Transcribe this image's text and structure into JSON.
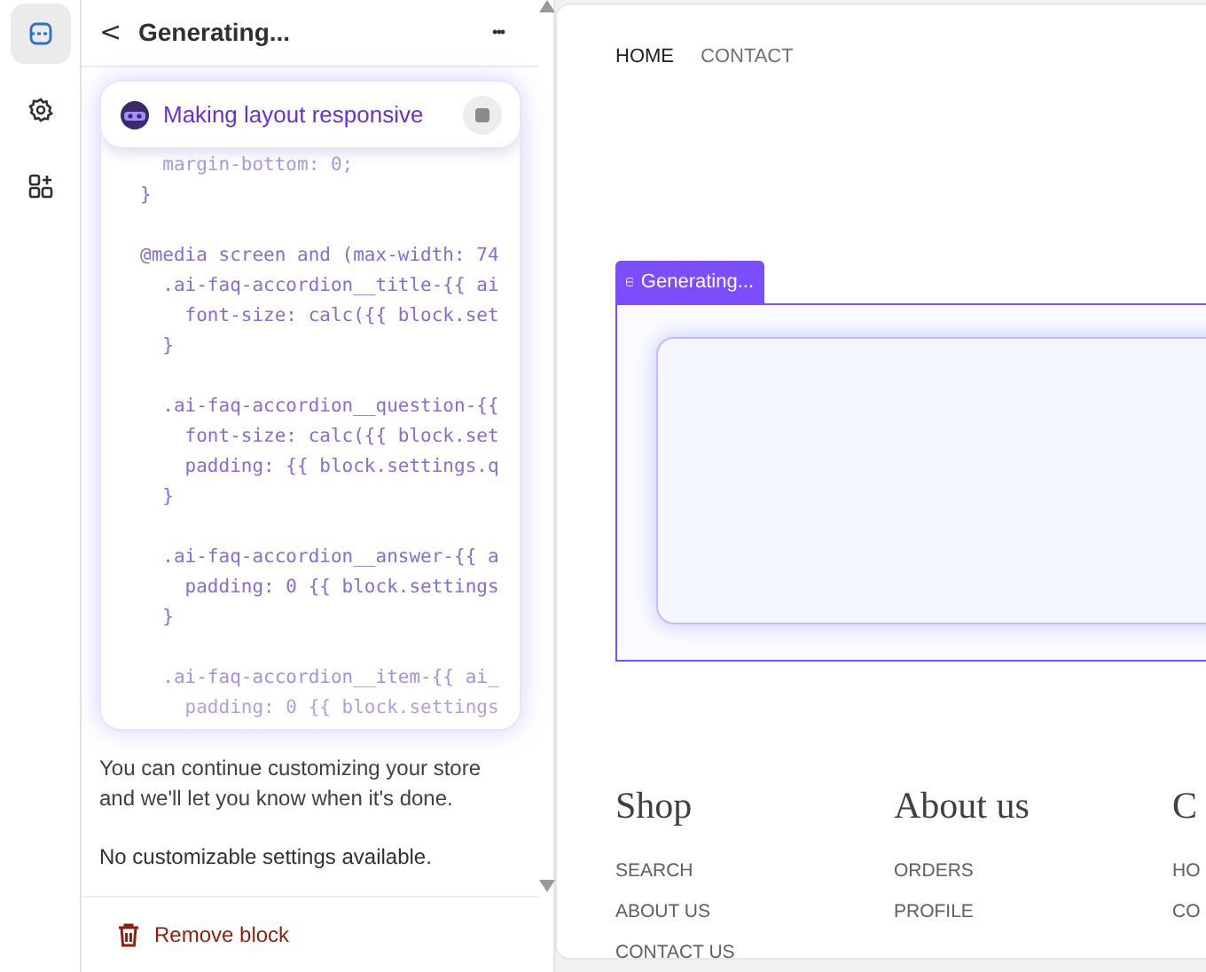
{
  "rail": [
    {
      "selected": true
    },
    {
      "selected": false
    },
    {
      "selected": false
    }
  ],
  "header": {
    "back": "<",
    "title": "Generating...",
    "more": "•••"
  },
  "status": {
    "text": "Making layout responsive"
  },
  "code_groups": [
    [
      "  margin-bottom: 0;",
      "}"
    ],
    [
      "@media screen and (max-width: 74",
      "  .ai-faq-accordion__title-{{ ai",
      "    font-size: calc({{ block.set",
      "  }"
    ],
    [
      "  .ai-faq-accordion__question-{{",
      "    font-size: calc({{ block.set",
      "    padding: {{ block.settings.q",
      "  }"
    ],
    [
      "  .ai-faq-accordion__answer-{{ a",
      "    padding: 0 {{ block.settings",
      "  }"
    ],
    [
      "  .ai-faq-accordion__item-{{ ai_",
      "    padding: 0 {{ block.settings"
    ]
  ],
  "info": "You can continue customizing your store and we'll let you know when it's done.",
  "no_settings": "No customizable settings available.",
  "remove_button": "Remove block",
  "preview": {
    "nav": [
      {
        "label": "HOME",
        "selected": true
      },
      {
        "label": "CONTACT",
        "selected": false
      }
    ],
    "badge": "Generating...",
    "footer": [
      {
        "heading": "Shop",
        "links": [
          "SEARCH",
          "ABOUT US",
          "CONTACT US"
        ]
      },
      {
        "heading": "About us",
        "links": [
          "ORDERS",
          "PROFILE"
        ]
      },
      {
        "heading": "C",
        "links": [
          "HO",
          "CO"
        ]
      }
    ]
  }
}
